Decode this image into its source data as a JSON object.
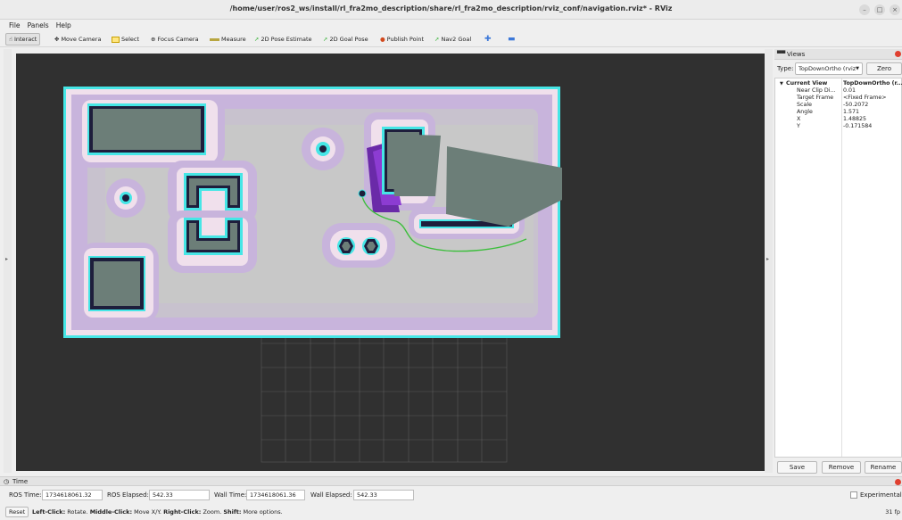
{
  "window": {
    "title": "/home/user/ros2_ws/install/rl_fra2mo_description/share/rl_fra2mo_description/rviz_conf/navigation.rviz* - RViz"
  },
  "menu": [
    "File",
    "Panels",
    "Help"
  ],
  "toolbar": [
    {
      "label": "Interact",
      "icon": "interact-icon",
      "active": true
    },
    {
      "label": "Move Camera",
      "icon": "move-camera-icon"
    },
    {
      "label": "Select",
      "icon": "select-icon"
    },
    {
      "label": "Focus Camera",
      "icon": "focus-camera-icon"
    },
    {
      "label": "Measure",
      "icon": "measure-icon"
    },
    {
      "label": "2D Pose Estimate",
      "icon": "pose-estimate-icon"
    },
    {
      "label": "2D Goal Pose",
      "icon": "goal-pose-icon"
    },
    {
      "label": "Publish Point",
      "icon": "publish-point-icon"
    },
    {
      "label": "Nav2 Goal",
      "icon": "nav2-goal-icon"
    }
  ],
  "views": {
    "title": "Views",
    "type_label": "Type:",
    "type_value": "TopDownOrtho (rviz",
    "zero_label": "Zero",
    "current_view_label": "Current View",
    "current_view_value": "TopDownOrtho (r...",
    "properties": [
      {
        "key": "Near Clip Di...",
        "value": "0.01"
      },
      {
        "key": "Target Frame",
        "value": "<Fixed Frame>"
      },
      {
        "key": "Scale",
        "value": "-50.2072"
      },
      {
        "key": "Angle",
        "value": "1.571"
      },
      {
        "key": "X",
        "value": "1.48825"
      },
      {
        "key": "Y",
        "value": "-0.171584"
      }
    ],
    "buttons": {
      "save": "Save",
      "remove": "Remove",
      "rename": "Rename"
    }
  },
  "time": {
    "title": "Time",
    "ros_time_label": "ROS Time:",
    "ros_time": "1734618061.32",
    "ros_elapsed_label": "ROS Elapsed:",
    "ros_elapsed": "542.33",
    "wall_time_label": "Wall Time:",
    "wall_time": "1734618061.36",
    "wall_elapsed_label": "Wall Elapsed:",
    "wall_elapsed": "542.33",
    "experimental_label": "Experimental"
  },
  "status": {
    "reset_label": "Reset",
    "left_click": "Left-Click:",
    "left_click_desc": "Rotate.",
    "middle_click": "Middle-Click:",
    "middle_click_desc": "Move X/Y.",
    "right_click": "Right-Click:",
    "right_click_desc": "Zoom.",
    "shift": "Shift:",
    "shift_desc": "More options.",
    "fps": "31 fp"
  },
  "colors": {
    "map_free": "#c8c8c8",
    "costmap_lavender": "#c8b4dc",
    "costmap_cyan": "#46e6e6",
    "obstacle": "#222244",
    "laser_scan": "#6a2aa8",
    "path": "#3cbe3c",
    "occluded": "#6c7e78"
  }
}
